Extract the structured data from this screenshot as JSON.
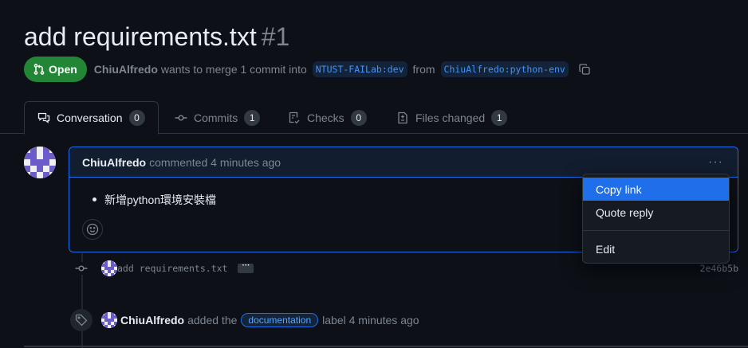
{
  "pr": {
    "title": "add requirements.txt",
    "number": "#1",
    "state": "Open",
    "author": "ChiuAlfredo",
    "merge_text": "wants to merge 1 commit into",
    "base_branch": "NTUST-FAILab:dev",
    "from_text": "from",
    "head_branch": "ChiuAlfredo:python-env"
  },
  "tabs": [
    {
      "label": "Conversation",
      "count": "0",
      "icon": "comment-discussion-icon"
    },
    {
      "label": "Commits",
      "count": "1",
      "icon": "git-commit-icon"
    },
    {
      "label": "Checks",
      "count": "0",
      "icon": "checklist-icon"
    },
    {
      "label": "Files changed",
      "count": "1",
      "icon": "file-diff-icon"
    }
  ],
  "comment": {
    "author": "ChiuAlfredo",
    "action": "commented 4 minutes ago",
    "body_item": "新增python環境安裝檔"
  },
  "commit_event": {
    "message": "add requirements.txt",
    "sha": "2e46b5b"
  },
  "label_event": {
    "author": "ChiuAlfredo",
    "pre_text": "added the",
    "label": "documentation",
    "post_text": "label 4 minutes ago"
  },
  "context_menu": {
    "items": [
      "Copy link",
      "Quote reply",
      "Edit"
    ]
  },
  "colors": {
    "background": "#0d1117",
    "open_green": "#238636",
    "accent_blue": "#1f6feb"
  }
}
